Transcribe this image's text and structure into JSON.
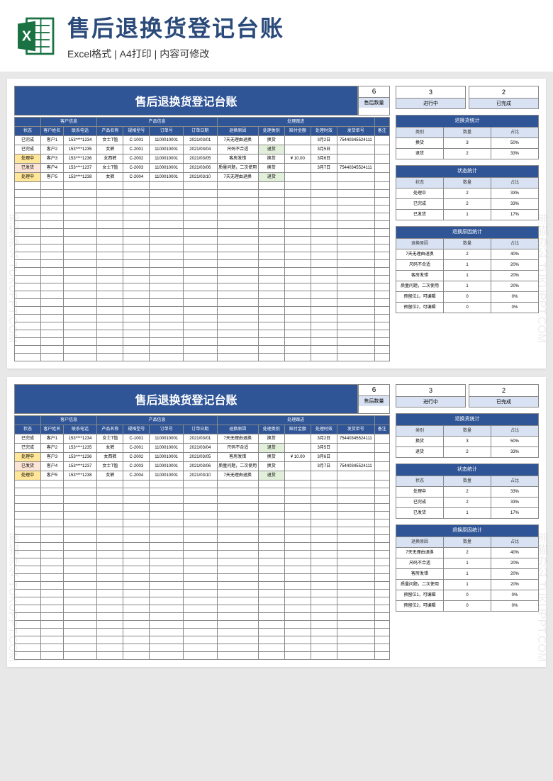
{
  "header": {
    "title": "售后退换货登记台账",
    "subtitle": "Excel格式 | A4打印 | 内容可修改"
  },
  "sheet": {
    "title": "售后退换货登记台账",
    "summary_count": "6",
    "summary_label": "售后数量",
    "side_boxes": {
      "left_num": "3",
      "left_label": "进行中",
      "right_num": "2",
      "right_label": "已完成"
    },
    "groups": [
      "",
      "客户信息",
      "产品信息",
      "处理跟进",
      ""
    ],
    "columns": [
      "状态",
      "客户姓名",
      "联系电话",
      "产品名称",
      "规格型号",
      "订单号",
      "订单日期",
      "退换原因",
      "处理类别",
      "赔付金额",
      "处理时效",
      "发货单号",
      "备注"
    ],
    "rows": [
      {
        "status": "已完成",
        "scls": "status-done",
        "name": "客户1",
        "phone": "153****1234",
        "prod": "女士T恤",
        "spec": "C-1001",
        "order": "1100010001",
        "date": "2021/03/01",
        "reason": "7天无理由退换",
        "type": "换货",
        "tcls": "",
        "amt": "",
        "proc": "3月2日",
        "ship": "75440345524111",
        "note": ""
      },
      {
        "status": "已完成",
        "scls": "status-done",
        "name": "客户2",
        "phone": "153****1235",
        "prod": "女裤",
        "spec": "C-2001",
        "order": "1100010001",
        "date": "2021/03/04",
        "reason": "尺码不合适",
        "type": "退货",
        "tcls": "tag-return",
        "amt": "",
        "proc": "3月5日",
        "ship": "",
        "note": ""
      },
      {
        "status": "处理中",
        "scls": "status-proc",
        "name": "客户3",
        "phone": "153****1236",
        "prod": "女西裤",
        "spec": "C-2002",
        "order": "1100010001",
        "date": "2021/03/05",
        "reason": "客房发错",
        "type": "换货",
        "tcls": "",
        "amt": "¥ 10.00",
        "proc": "3月6日",
        "ship": "",
        "note": ""
      },
      {
        "status": "已发货",
        "scls": "status-ship",
        "name": "客户4",
        "phone": "153****1237",
        "prod": "女士T恤",
        "spec": "C-2003",
        "order": "1100010001",
        "date": "2021/03/06",
        "reason": "质量问题，二次使用",
        "type": "换货",
        "tcls": "",
        "amt": "",
        "proc": "3月7日",
        "ship": "75440345524111",
        "note": ""
      },
      {
        "status": "处理中",
        "scls": "status-proc",
        "name": "客户5",
        "phone": "153****1238",
        "prod": "女裤",
        "spec": "C-2004",
        "order": "1100010001",
        "date": "2021/03/10",
        "reason": "7天无理由退换",
        "type": "退货",
        "tcls": "tag-return",
        "amt": "",
        "proc": "",
        "ship": "",
        "note": ""
      }
    ],
    "empty_rows": 23
  },
  "stats": {
    "return_type": {
      "title": "退换货统计",
      "headers": [
        "类别",
        "数量",
        "占比"
      ],
      "rows": [
        [
          "换货",
          "3",
          "50%"
        ],
        [
          "退货",
          "2",
          "33%"
        ]
      ]
    },
    "status": {
      "title": "状态统计",
      "headers": [
        "状态",
        "数量",
        "占比"
      ],
      "rows": [
        [
          "处理中",
          "2",
          "33%"
        ],
        [
          "已完成",
          "2",
          "33%"
        ],
        [
          "已发货",
          "1",
          "17%"
        ]
      ]
    },
    "reason": {
      "title": "退换原因统计",
      "headers": [
        "退换原因",
        "数量",
        "占比"
      ],
      "rows": [
        [
          "7天无理由退换",
          "2",
          "40%"
        ],
        [
          "尺码不合适",
          "1",
          "20%"
        ],
        [
          "客房发错",
          "1",
          "20%"
        ],
        [
          "质量问题，二次使用",
          "1",
          "20%"
        ],
        [
          "预留位1，可编辑",
          "0",
          "0%"
        ],
        [
          "预留位2，可编辑",
          "0",
          "0%"
        ]
      ]
    }
  },
  "watermark": "熊猫办公 TUKUPPT.COM"
}
